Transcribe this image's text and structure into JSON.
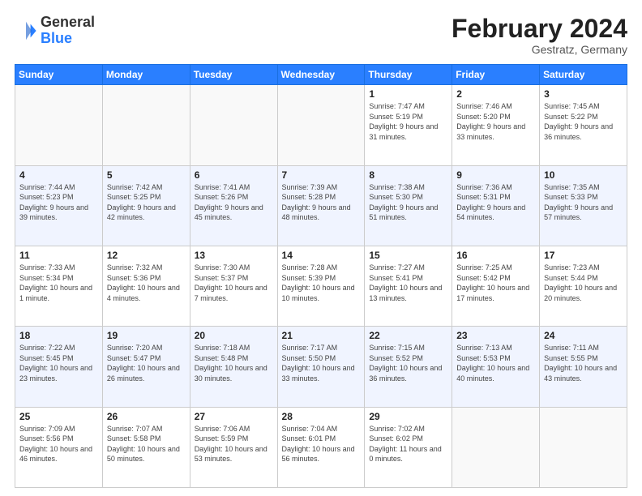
{
  "header": {
    "logo_general": "General",
    "logo_blue": "Blue",
    "month_year": "February 2024",
    "location": "Gestratz, Germany"
  },
  "days_of_week": [
    "Sunday",
    "Monday",
    "Tuesday",
    "Wednesday",
    "Thursday",
    "Friday",
    "Saturday"
  ],
  "weeks": [
    [
      {
        "day": "",
        "info": ""
      },
      {
        "day": "",
        "info": ""
      },
      {
        "day": "",
        "info": ""
      },
      {
        "day": "",
        "info": ""
      },
      {
        "day": "1",
        "info": "Sunrise: 7:47 AM\nSunset: 5:19 PM\nDaylight: 9 hours and 31 minutes."
      },
      {
        "day": "2",
        "info": "Sunrise: 7:46 AM\nSunset: 5:20 PM\nDaylight: 9 hours and 33 minutes."
      },
      {
        "day": "3",
        "info": "Sunrise: 7:45 AM\nSunset: 5:22 PM\nDaylight: 9 hours and 36 minutes."
      }
    ],
    [
      {
        "day": "4",
        "info": "Sunrise: 7:44 AM\nSunset: 5:23 PM\nDaylight: 9 hours and 39 minutes."
      },
      {
        "day": "5",
        "info": "Sunrise: 7:42 AM\nSunset: 5:25 PM\nDaylight: 9 hours and 42 minutes."
      },
      {
        "day": "6",
        "info": "Sunrise: 7:41 AM\nSunset: 5:26 PM\nDaylight: 9 hours and 45 minutes."
      },
      {
        "day": "7",
        "info": "Sunrise: 7:39 AM\nSunset: 5:28 PM\nDaylight: 9 hours and 48 minutes."
      },
      {
        "day": "8",
        "info": "Sunrise: 7:38 AM\nSunset: 5:30 PM\nDaylight: 9 hours and 51 minutes."
      },
      {
        "day": "9",
        "info": "Sunrise: 7:36 AM\nSunset: 5:31 PM\nDaylight: 9 hours and 54 minutes."
      },
      {
        "day": "10",
        "info": "Sunrise: 7:35 AM\nSunset: 5:33 PM\nDaylight: 9 hours and 57 minutes."
      }
    ],
    [
      {
        "day": "11",
        "info": "Sunrise: 7:33 AM\nSunset: 5:34 PM\nDaylight: 10 hours and 1 minute."
      },
      {
        "day": "12",
        "info": "Sunrise: 7:32 AM\nSunset: 5:36 PM\nDaylight: 10 hours and 4 minutes."
      },
      {
        "day": "13",
        "info": "Sunrise: 7:30 AM\nSunset: 5:37 PM\nDaylight: 10 hours and 7 minutes."
      },
      {
        "day": "14",
        "info": "Sunrise: 7:28 AM\nSunset: 5:39 PM\nDaylight: 10 hours and 10 minutes."
      },
      {
        "day": "15",
        "info": "Sunrise: 7:27 AM\nSunset: 5:41 PM\nDaylight: 10 hours and 13 minutes."
      },
      {
        "day": "16",
        "info": "Sunrise: 7:25 AM\nSunset: 5:42 PM\nDaylight: 10 hours and 17 minutes."
      },
      {
        "day": "17",
        "info": "Sunrise: 7:23 AM\nSunset: 5:44 PM\nDaylight: 10 hours and 20 minutes."
      }
    ],
    [
      {
        "day": "18",
        "info": "Sunrise: 7:22 AM\nSunset: 5:45 PM\nDaylight: 10 hours and 23 minutes."
      },
      {
        "day": "19",
        "info": "Sunrise: 7:20 AM\nSunset: 5:47 PM\nDaylight: 10 hours and 26 minutes."
      },
      {
        "day": "20",
        "info": "Sunrise: 7:18 AM\nSunset: 5:48 PM\nDaylight: 10 hours and 30 minutes."
      },
      {
        "day": "21",
        "info": "Sunrise: 7:17 AM\nSunset: 5:50 PM\nDaylight: 10 hours and 33 minutes."
      },
      {
        "day": "22",
        "info": "Sunrise: 7:15 AM\nSunset: 5:52 PM\nDaylight: 10 hours and 36 minutes."
      },
      {
        "day": "23",
        "info": "Sunrise: 7:13 AM\nSunset: 5:53 PM\nDaylight: 10 hours and 40 minutes."
      },
      {
        "day": "24",
        "info": "Sunrise: 7:11 AM\nSunset: 5:55 PM\nDaylight: 10 hours and 43 minutes."
      }
    ],
    [
      {
        "day": "25",
        "info": "Sunrise: 7:09 AM\nSunset: 5:56 PM\nDaylight: 10 hours and 46 minutes."
      },
      {
        "day": "26",
        "info": "Sunrise: 7:07 AM\nSunset: 5:58 PM\nDaylight: 10 hours and 50 minutes."
      },
      {
        "day": "27",
        "info": "Sunrise: 7:06 AM\nSunset: 5:59 PM\nDaylight: 10 hours and 53 minutes."
      },
      {
        "day": "28",
        "info": "Sunrise: 7:04 AM\nSunset: 6:01 PM\nDaylight: 10 hours and 56 minutes."
      },
      {
        "day": "29",
        "info": "Sunrise: 7:02 AM\nSunset: 6:02 PM\nDaylight: 11 hours and 0 minutes."
      },
      {
        "day": "",
        "info": ""
      },
      {
        "day": "",
        "info": ""
      }
    ]
  ]
}
